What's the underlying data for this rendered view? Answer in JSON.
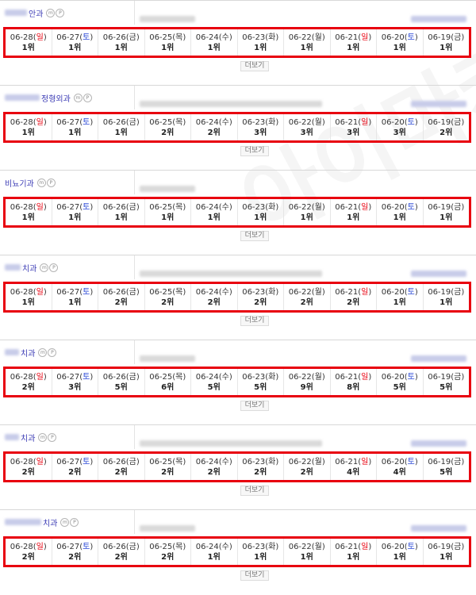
{
  "blocks": [
    {
      "dept": "안과",
      "dates": [
        {
          "d": "06-28",
          "w": "일",
          "k": "sun"
        },
        {
          "d": "06-27",
          "w": "토",
          "k": "sat"
        },
        {
          "d": "06-26",
          "w": "금",
          "k": ""
        },
        {
          "d": "06-25",
          "w": "목",
          "k": ""
        },
        {
          "d": "06-24",
          "w": "수",
          "k": ""
        },
        {
          "d": "06-23",
          "w": "화",
          "k": ""
        },
        {
          "d": "06-22",
          "w": "월",
          "k": ""
        },
        {
          "d": "06-21",
          "w": "일",
          "k": "sun"
        },
        {
          "d": "06-20",
          "w": "토",
          "k": "sat"
        },
        {
          "d": "06-19",
          "w": "금",
          "k": ""
        }
      ],
      "ranks": [
        "1위",
        "1위",
        "1위",
        "1위",
        "1위",
        "1위",
        "1위",
        "1위",
        "1위",
        "1위"
      ],
      "more_label": "더보기"
    },
    {
      "dept": "정형외과",
      "dates": [
        {
          "d": "06-28",
          "w": "일",
          "k": "sun"
        },
        {
          "d": "06-27",
          "w": "토",
          "k": "sat"
        },
        {
          "d": "06-26",
          "w": "금",
          "k": ""
        },
        {
          "d": "06-25",
          "w": "목",
          "k": ""
        },
        {
          "d": "06-24",
          "w": "수",
          "k": ""
        },
        {
          "d": "06-23",
          "w": "화",
          "k": ""
        },
        {
          "d": "06-22",
          "w": "월",
          "k": ""
        },
        {
          "d": "06-21",
          "w": "일",
          "k": "sun"
        },
        {
          "d": "06-20",
          "w": "토",
          "k": "sat"
        },
        {
          "d": "06-19",
          "w": "금",
          "k": ""
        }
      ],
      "ranks": [
        "1위",
        "1위",
        "1위",
        "2위",
        "2위",
        "3위",
        "3위",
        "3위",
        "3위",
        "2위"
      ],
      "more_label": "더보기"
    },
    {
      "dept": "비뇨기과",
      "dates": [
        {
          "d": "06-28",
          "w": "일",
          "k": "sun"
        },
        {
          "d": "06-27",
          "w": "토",
          "k": "sat"
        },
        {
          "d": "06-26",
          "w": "금",
          "k": ""
        },
        {
          "d": "06-25",
          "w": "목",
          "k": ""
        },
        {
          "d": "06-24",
          "w": "수",
          "k": ""
        },
        {
          "d": "06-23",
          "w": "화",
          "k": ""
        },
        {
          "d": "06-22",
          "w": "월",
          "k": ""
        },
        {
          "d": "06-21",
          "w": "일",
          "k": "sun"
        },
        {
          "d": "06-20",
          "w": "토",
          "k": "sat"
        },
        {
          "d": "06-19",
          "w": "금",
          "k": ""
        }
      ],
      "ranks": [
        "1위",
        "1위",
        "1위",
        "1위",
        "1위",
        "1위",
        "1위",
        "1위",
        "1위",
        "1위"
      ],
      "more_label": "더보기"
    },
    {
      "dept": "치과",
      "dates": [
        {
          "d": "06-28",
          "w": "일",
          "k": "sun"
        },
        {
          "d": "06-27",
          "w": "토",
          "k": "sat"
        },
        {
          "d": "06-26",
          "w": "금",
          "k": ""
        },
        {
          "d": "06-25",
          "w": "목",
          "k": ""
        },
        {
          "d": "06-24",
          "w": "수",
          "k": ""
        },
        {
          "d": "06-23",
          "w": "화",
          "k": ""
        },
        {
          "d": "06-22",
          "w": "월",
          "k": ""
        },
        {
          "d": "06-21",
          "w": "일",
          "k": "sun"
        },
        {
          "d": "06-20",
          "w": "토",
          "k": "sat"
        },
        {
          "d": "06-19",
          "w": "금",
          "k": ""
        }
      ],
      "ranks": [
        "1위",
        "1위",
        "2위",
        "2위",
        "2위",
        "2위",
        "2위",
        "2위",
        "1위",
        "1위"
      ],
      "more_label": "더보기"
    },
    {
      "dept": "치과",
      "dates": [
        {
          "d": "06-28",
          "w": "일",
          "k": "sun"
        },
        {
          "d": "06-27",
          "w": "토",
          "k": "sat"
        },
        {
          "d": "06-26",
          "w": "금",
          "k": ""
        },
        {
          "d": "06-25",
          "w": "목",
          "k": ""
        },
        {
          "d": "06-24",
          "w": "수",
          "k": ""
        },
        {
          "d": "06-23",
          "w": "화",
          "k": ""
        },
        {
          "d": "06-22",
          "w": "월",
          "k": ""
        },
        {
          "d": "06-21",
          "w": "일",
          "k": "sun"
        },
        {
          "d": "06-20",
          "w": "토",
          "k": "sat"
        },
        {
          "d": "06-19",
          "w": "금",
          "k": ""
        }
      ],
      "ranks": [
        "2위",
        "3위",
        "5위",
        "6위",
        "5위",
        "5위",
        "9위",
        "8위",
        "5위",
        "5위"
      ],
      "more_label": "더보기"
    },
    {
      "dept": "치과",
      "dates": [
        {
          "d": "06-28",
          "w": "일",
          "k": "sun"
        },
        {
          "d": "06-27",
          "w": "토",
          "k": "sat"
        },
        {
          "d": "06-26",
          "w": "금",
          "k": ""
        },
        {
          "d": "06-25",
          "w": "목",
          "k": ""
        },
        {
          "d": "06-24",
          "w": "수",
          "k": ""
        },
        {
          "d": "06-23",
          "w": "화",
          "k": ""
        },
        {
          "d": "06-22",
          "w": "월",
          "k": ""
        },
        {
          "d": "06-21",
          "w": "일",
          "k": "sun"
        },
        {
          "d": "06-20",
          "w": "토",
          "k": "sat"
        },
        {
          "d": "06-19",
          "w": "금",
          "k": ""
        }
      ],
      "ranks": [
        "2위",
        "2위",
        "2위",
        "2위",
        "2위",
        "2위",
        "2위",
        "4위",
        "4위",
        "5위"
      ],
      "more_label": "더보기"
    },
    {
      "dept": "치과",
      "dates": [
        {
          "d": "06-28",
          "w": "일",
          "k": "sun"
        },
        {
          "d": "06-27",
          "w": "토",
          "k": "sat"
        },
        {
          "d": "06-26",
          "w": "금",
          "k": ""
        },
        {
          "d": "06-25",
          "w": "목",
          "k": ""
        },
        {
          "d": "06-24",
          "w": "수",
          "k": ""
        },
        {
          "d": "06-23",
          "w": "화",
          "k": ""
        },
        {
          "d": "06-22",
          "w": "월",
          "k": ""
        },
        {
          "d": "06-21",
          "w": "일",
          "k": "sun"
        },
        {
          "d": "06-20",
          "w": "토",
          "k": "sat"
        },
        {
          "d": "06-19",
          "w": "금",
          "k": ""
        }
      ],
      "ranks": [
        "2위",
        "2위",
        "2위",
        "2위",
        "1위",
        "1위",
        "1위",
        "1위",
        "1위",
        "1위"
      ],
      "more_label": "더보기"
    }
  ],
  "badges": {
    "m": "m",
    "p": "P"
  },
  "colors": {
    "highlight": "#e8000f",
    "sunday": "#e8000f",
    "saturday": "#2a48d6",
    "dept": "#3c3cb5"
  }
}
